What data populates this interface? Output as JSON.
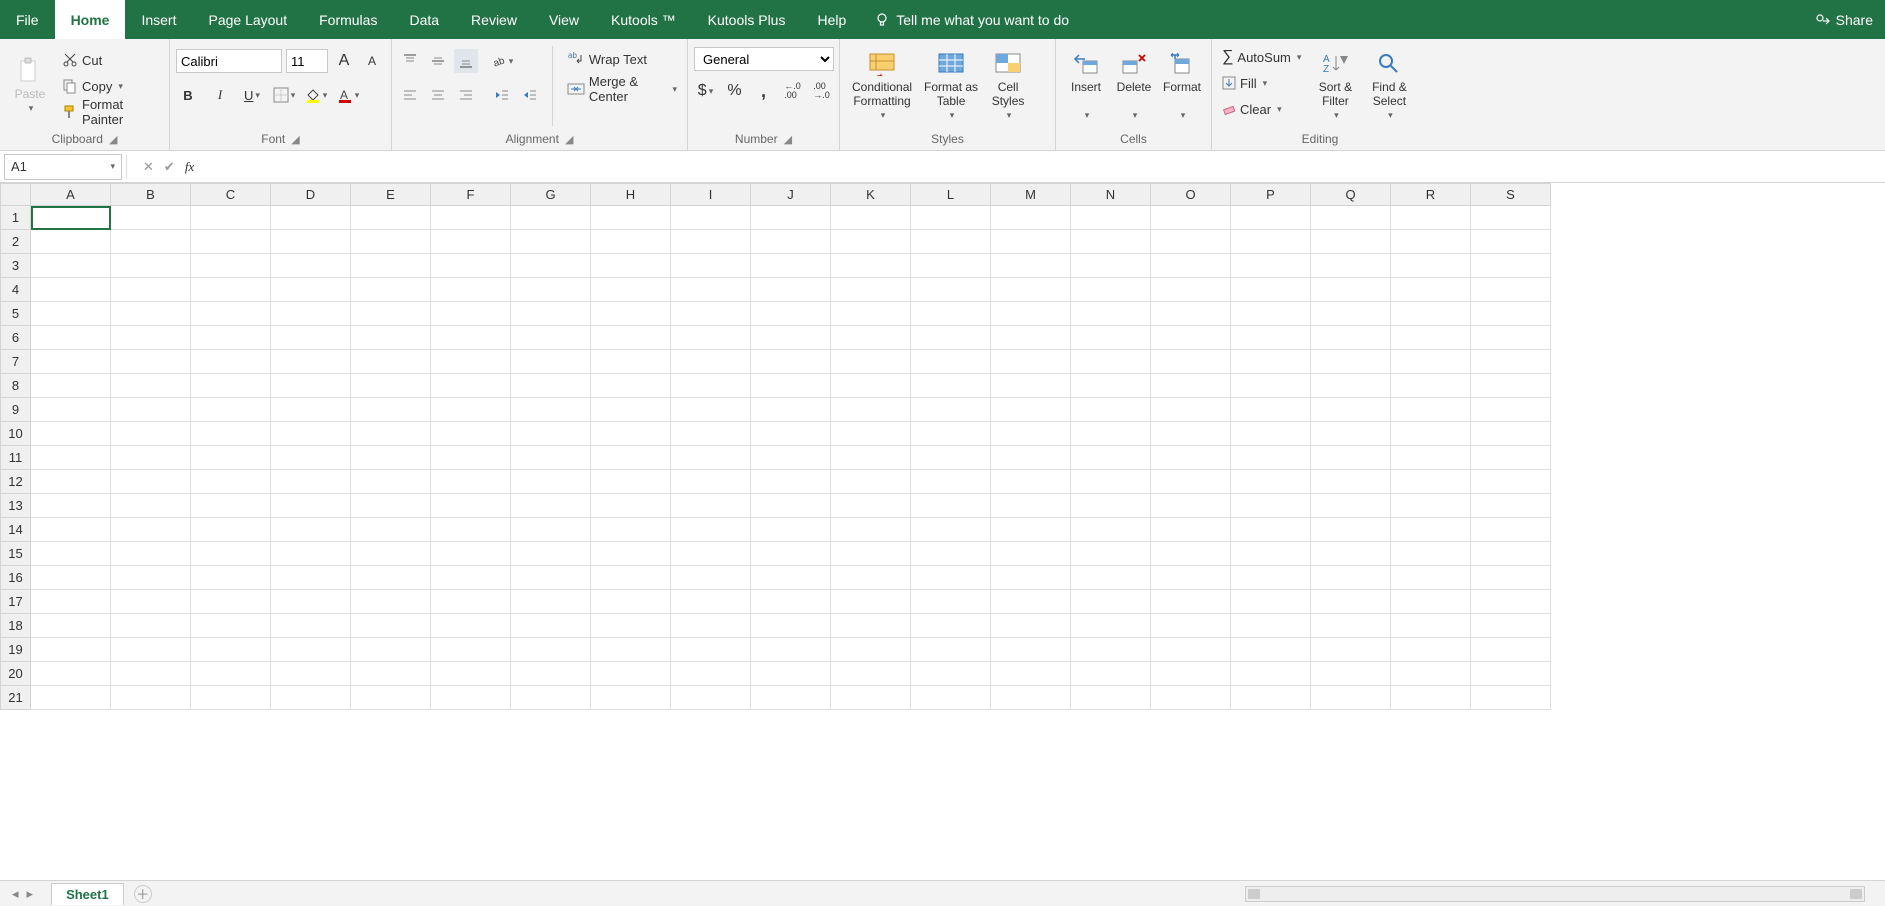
{
  "tabs": {
    "file": "File",
    "home": "Home",
    "insert": "Insert",
    "pagelayout": "Page Layout",
    "formulas": "Formulas",
    "data": "Data",
    "review": "Review",
    "view": "View",
    "kutools": "Kutools ™",
    "kutoolsplus": "Kutools Plus",
    "help": "Help",
    "tellme": "Tell me what you want to do",
    "share": "Share"
  },
  "clipboard": {
    "paste": "Paste",
    "cut": "Cut",
    "copy": "Copy",
    "formatpainter": "Format Painter",
    "label": "Clipboard"
  },
  "font": {
    "name": "Calibri",
    "size": "11",
    "label": "Font"
  },
  "alignment": {
    "wrap": "Wrap Text",
    "merge": "Merge & Center",
    "label": "Alignment"
  },
  "number": {
    "format": "General",
    "label": "Number"
  },
  "styles": {
    "conditional": "Conditional\nFormatting",
    "formattable": "Format as\nTable",
    "cellstyles": "Cell\nStyles",
    "label": "Styles"
  },
  "cells": {
    "insert": "Insert",
    "delete": "Delete",
    "format": "Format",
    "label": "Cells"
  },
  "editing": {
    "autosum": "AutoSum",
    "fill": "Fill",
    "clear": "Clear",
    "sortfilter": "Sort &\nFilter",
    "findselect": "Find &\nSelect",
    "label": "Editing"
  },
  "formulaBar": {
    "ref": "A1",
    "value": ""
  },
  "grid": {
    "columns": [
      "A",
      "B",
      "C",
      "D",
      "E",
      "F",
      "G",
      "H",
      "I",
      "J",
      "K",
      "L",
      "M",
      "N",
      "O",
      "P",
      "Q",
      "R",
      "S"
    ],
    "rows": [
      1,
      2,
      3,
      4,
      5,
      6,
      7,
      8,
      9,
      10,
      11,
      12,
      13,
      14,
      15,
      16,
      17,
      18,
      19,
      20,
      21
    ],
    "activeCell": "A1"
  },
  "sheets": {
    "active": "Sheet1"
  }
}
